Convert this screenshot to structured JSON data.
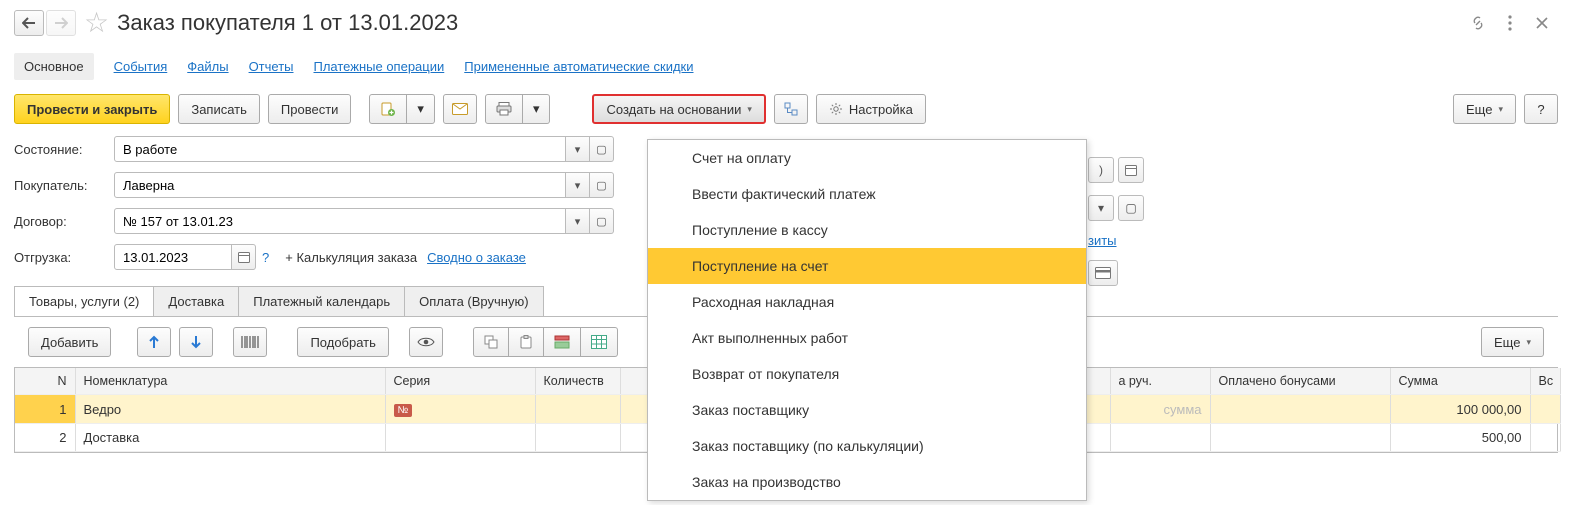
{
  "header": {
    "title": "Заказ покупателя 1 от 13.01.2023"
  },
  "tabs": {
    "main": "Основное",
    "events": "События",
    "files": "Файлы",
    "reports": "Отчеты",
    "payments": "Платежные операции",
    "discounts": "Примененные автоматические скидки"
  },
  "toolbar": {
    "post_close": "Провести и закрыть",
    "save": "Записать",
    "post": "Провести",
    "create_based": "Создать на основании",
    "settings": "Настройка",
    "more": "Еще"
  },
  "form": {
    "state_label": "Состояние:",
    "state_value": "В работе",
    "buyer_label": "Покупатель:",
    "buyer_value": "Лаверна",
    "contract_label": "Договор:",
    "contract_value": "№ 157 от 13.01.23",
    "props_link": "зиты",
    "ship_label": "Отгрузка:",
    "ship_date": "13.01.2023",
    "calc_link": "+ Калькуляция заказа",
    "summary_link": "Сводно о заказе"
  },
  "subtabs": {
    "goods": "Товары, услуги (2)",
    "delivery": "Доставка",
    "paycal": "Платежный календарь",
    "manualpay": "Оплата (Вручную)"
  },
  "subtoolbar": {
    "add": "Добавить",
    "pick": "Подобрать",
    "more": "Еще"
  },
  "grid": {
    "cols": {
      "n": "N",
      "item": "Номенклатура",
      "series": "Серия",
      "qty": "Количеств",
      "manual": "а руч.",
      "bonus": "Оплачено бонусами",
      "sum": "Сумма",
      "vs": "Вс"
    },
    "rows": [
      {
        "n": "1",
        "item": "Ведро",
        "series_badge": "№",
        "manual_ph": "сумма",
        "sum": "100 000,00"
      },
      {
        "n": "2",
        "item": "Доставка",
        "sum": "500,00"
      }
    ]
  },
  "menu": {
    "items": [
      "Счет на оплату",
      "Ввести фактический платеж",
      "Поступление в кассу",
      "Поступление на счет",
      "Расходная накладная",
      "Акт выполненных работ",
      "Возврат от покупателя",
      "Заказ поставщику",
      "Заказ поставщику (по калькуляции)",
      "Заказ на производство"
    ],
    "active_index": 3
  }
}
